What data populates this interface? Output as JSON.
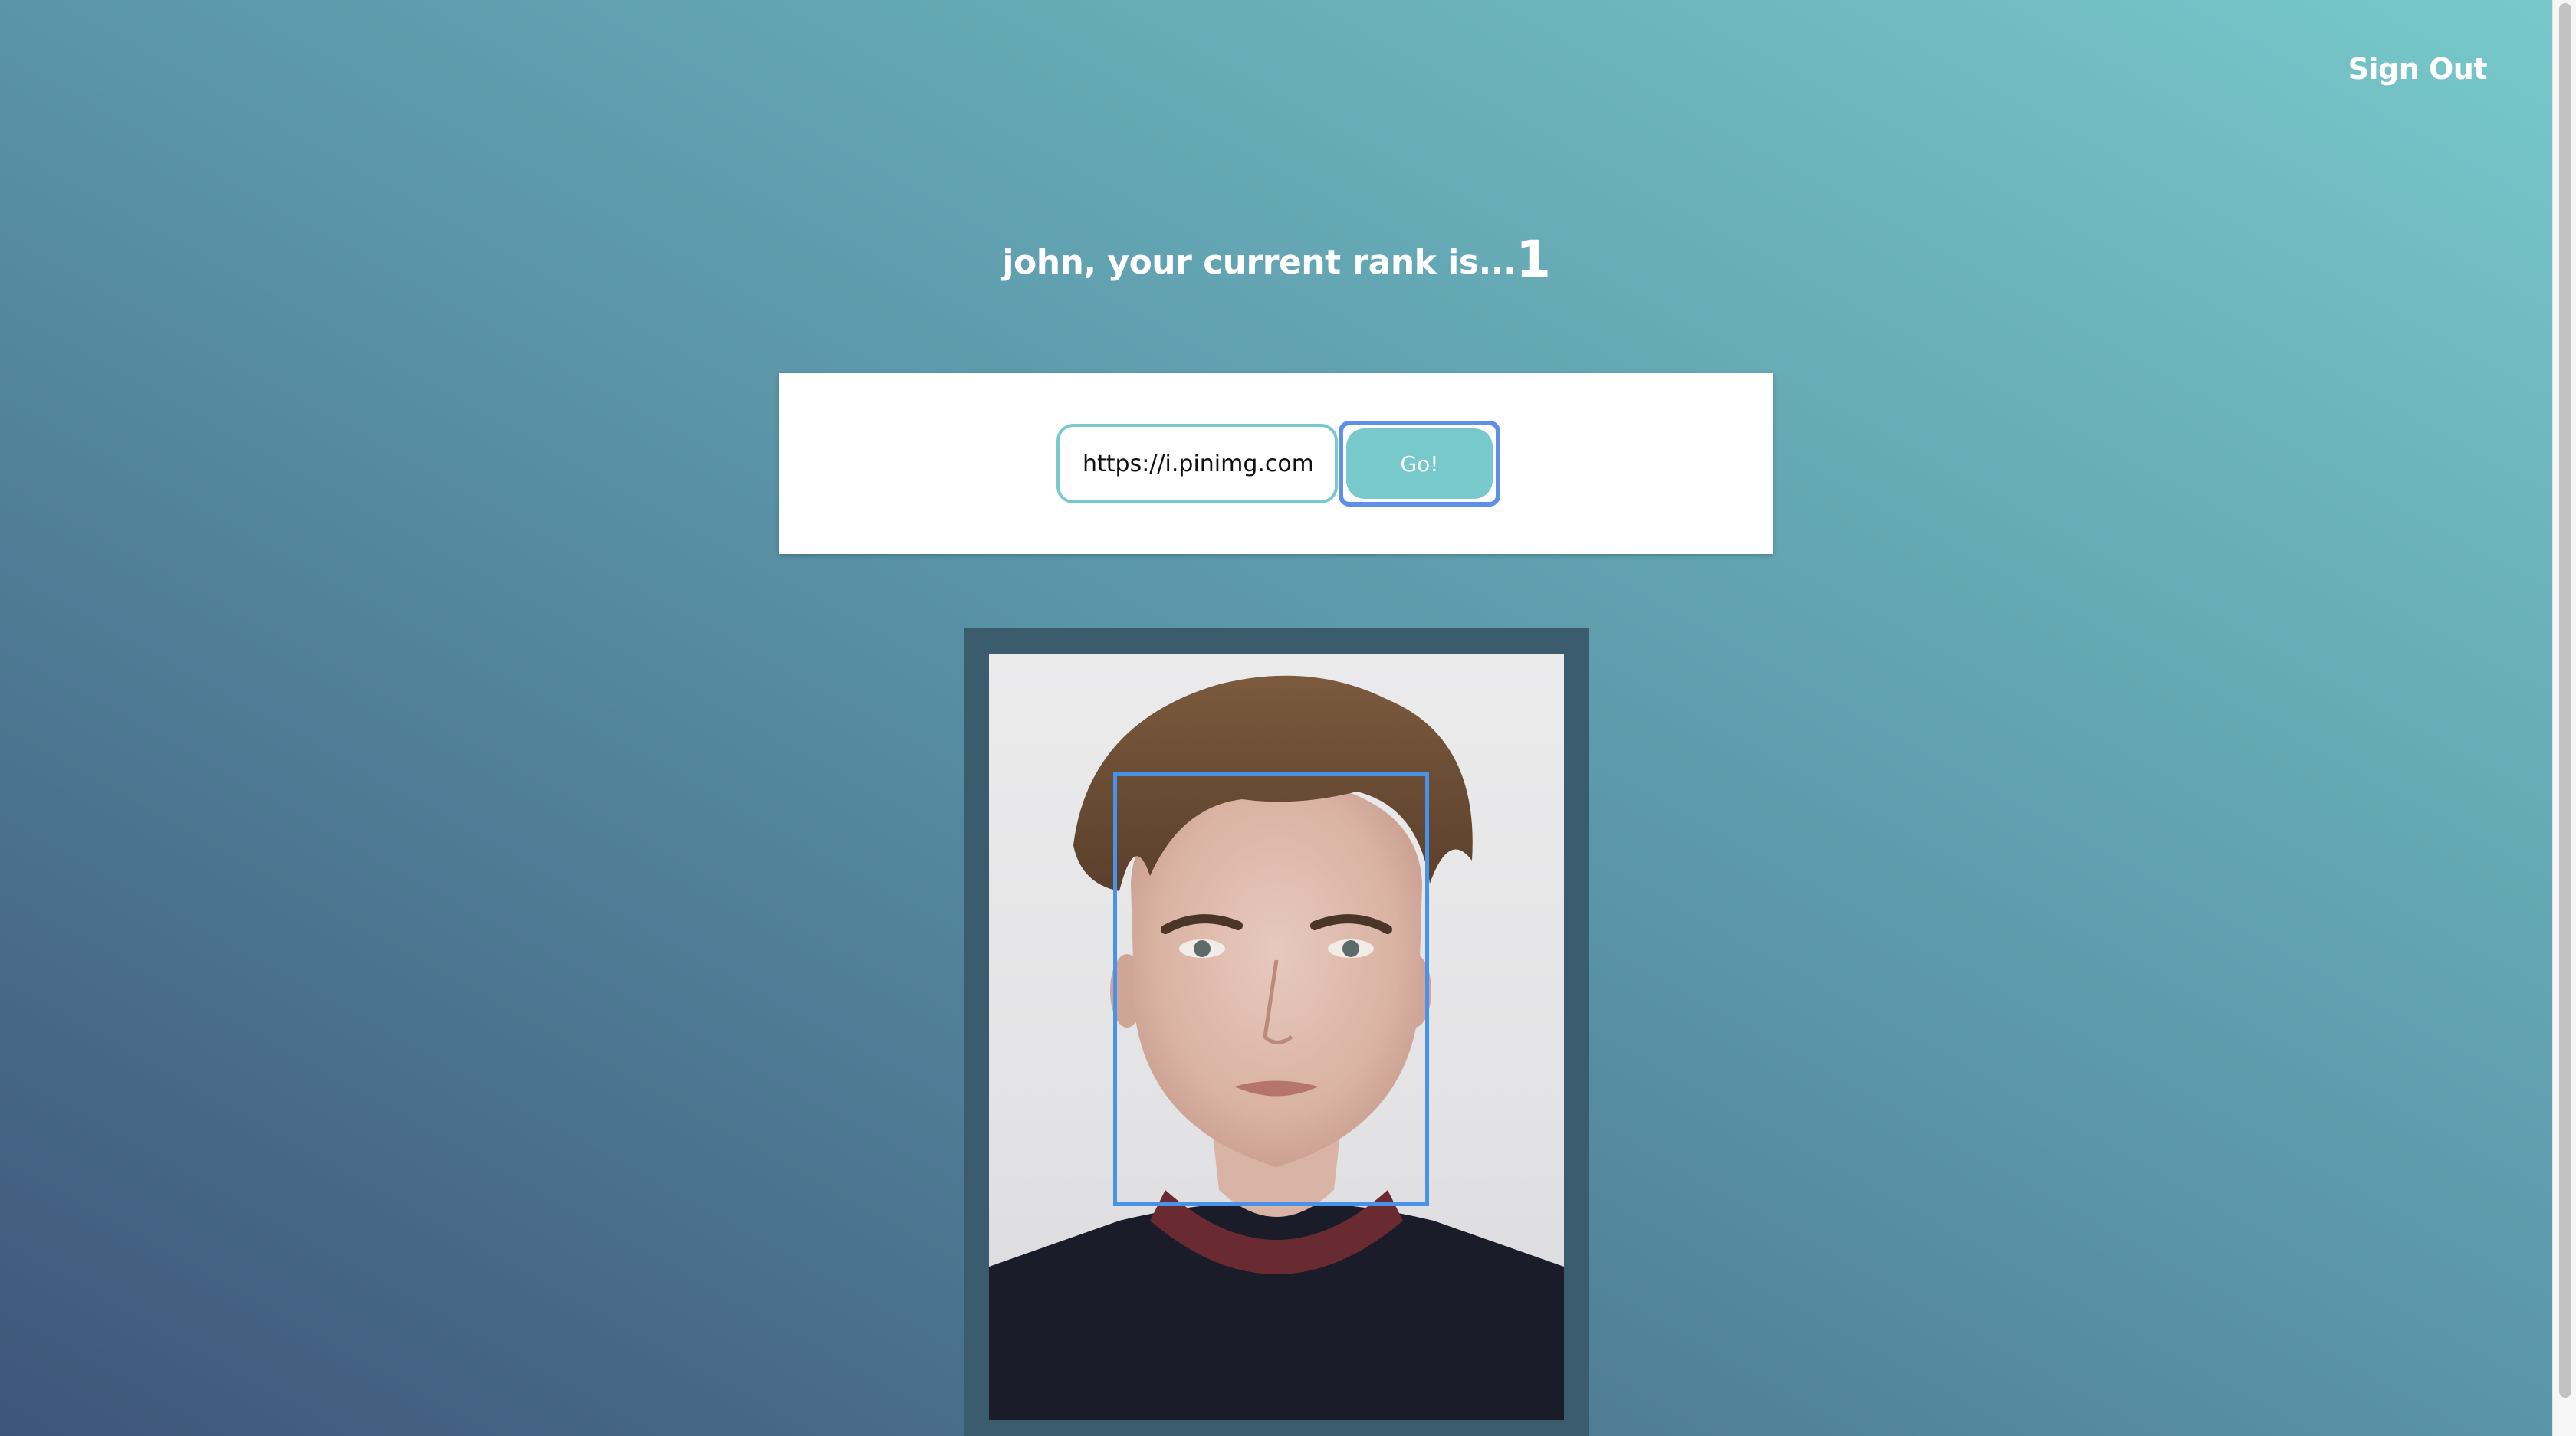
{
  "nav": {
    "signout_label": "Sign Out"
  },
  "rank": {
    "prefix": "john, your current rank is...",
    "value": "1"
  },
  "form": {
    "url_value": "https://i.pinimg.com/or",
    "submit_label": "Go!"
  },
  "image": {
    "subject": "portrait photo of a young man",
    "face_detection_box": true
  },
  "colors": {
    "accent": "#77c9cb",
    "focus_ring": "#5f90e8",
    "face_box": "#4a92e8",
    "frame": "#3a5c6c"
  }
}
